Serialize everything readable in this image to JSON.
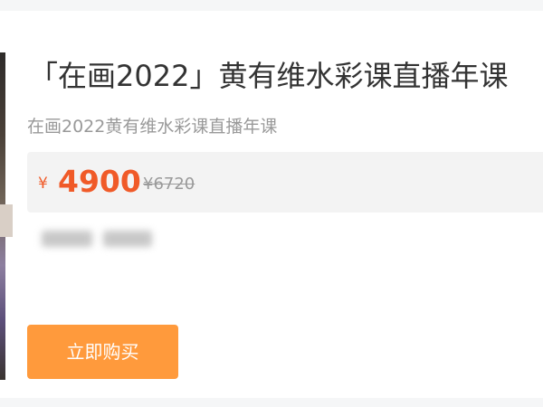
{
  "course": {
    "title": "「在画2022」黄有维水彩课直播年课",
    "subtitle": "在画2022黄有维水彩课直播年课",
    "currency_symbol": "¥",
    "price": "4900",
    "original_price": "¥6720",
    "buy_button_label": "立即购买"
  },
  "colors": {
    "accent": "#f05a28",
    "button": "#ff9a3c",
    "page_background": "#f5f6f7",
    "price_box_background": "#f3f3f3"
  }
}
